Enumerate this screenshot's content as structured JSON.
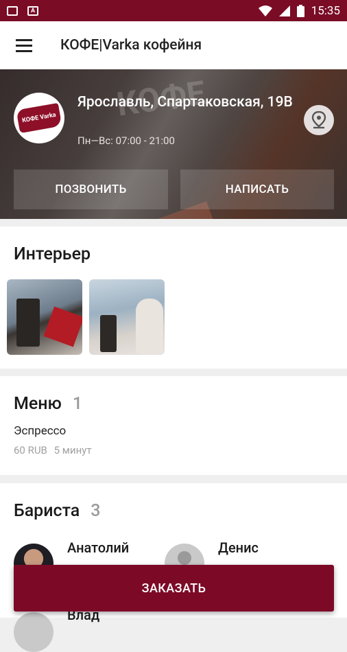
{
  "status_bar": {
    "time": "15:35"
  },
  "app_bar": {
    "title": "КОФЕ|Varka кофейня"
  },
  "hero": {
    "logo_text": "КОФЕ Varka",
    "address": "Ярославль, Спартаковская, 19В",
    "hours": "Пн—Вс: 07:00 - 21:00",
    "call_label": "ПОЗВОНИТЬ",
    "write_label": "НАПИСАТЬ"
  },
  "interior": {
    "title": "Интерьер"
  },
  "menu": {
    "title": "Меню",
    "count": "1",
    "items": [
      {
        "name": "Эспрессо",
        "price": "60 RUB",
        "time": "5 минут"
      }
    ]
  },
  "baristas": {
    "title": "Бариста",
    "count": "3",
    "people": [
      {
        "name": "Анатолий"
      },
      {
        "name": "Денис"
      },
      {
        "name": "Влад"
      }
    ]
  },
  "order_label": "ЗАКАЗАТЬ",
  "colors": {
    "brand": "#7c0a27",
    "status_bar": "#7a0c26"
  }
}
